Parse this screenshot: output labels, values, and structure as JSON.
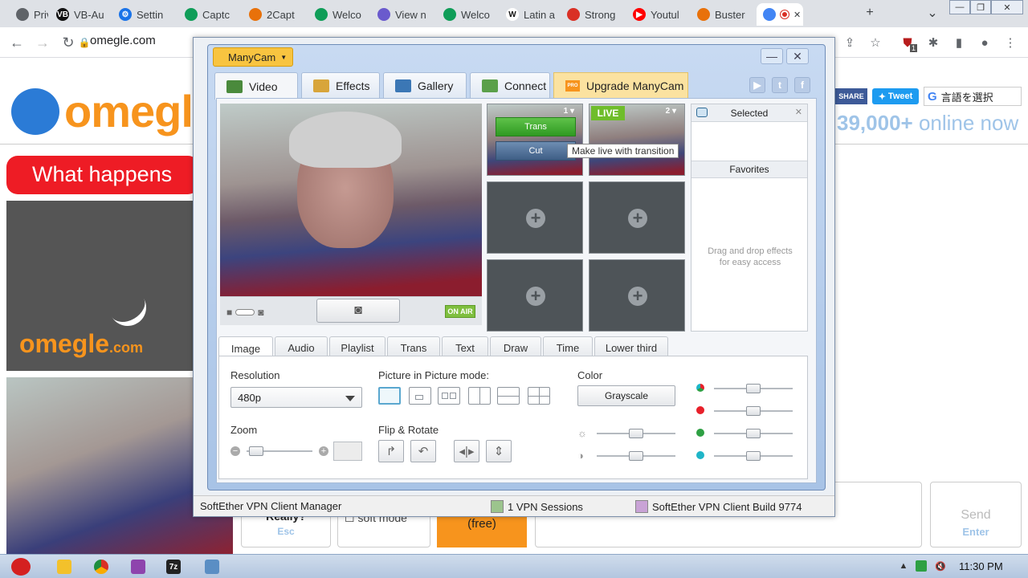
{
  "browser": {
    "tabs": [
      {
        "label": "Privac",
        "fav_color": "#5f6368",
        "fav_text": "",
        "active": false
      },
      {
        "label": "VB-Au",
        "fav_color": "#111111",
        "fav_text": "VB",
        "active": false
      },
      {
        "label": "Settin",
        "fav_color": "#1a73e8",
        "fav_text": "⚙",
        "active": false
      },
      {
        "label": "Captc",
        "fav_color": "#0f9d58",
        "fav_text": "",
        "active": false
      },
      {
        "label": "2Capt",
        "fav_color": "#e8710a",
        "fav_text": "",
        "active": false
      },
      {
        "label": "Welco",
        "fav_color": "#0f9d58",
        "fav_text": "",
        "active": false
      },
      {
        "label": "View n",
        "fav_color": "#6a5acd",
        "fav_text": "",
        "active": false
      },
      {
        "label": "Welco",
        "fav_color": "#0f9d58",
        "fav_text": "",
        "active": false
      },
      {
        "label": "Latin a",
        "fav_color": "#ffffff",
        "fav_text": "W",
        "active": false
      },
      {
        "label": "Strong",
        "fav_color": "#d93025",
        "fav_text": "",
        "active": false
      },
      {
        "label": "Youtul",
        "fav_color": "#ff0000",
        "fav_text": "▶",
        "active": false
      },
      {
        "label": "Buster",
        "fav_color": "#e8710a",
        "fav_text": "",
        "active": false
      },
      {
        "label": "",
        "fav_color": "#4285f4",
        "fav_text": "",
        "active": true
      }
    ],
    "url": "omegle.com",
    "extension_badge": "1"
  },
  "omegle": {
    "logo_text": "omegle",
    "share_label": "SHARE",
    "tweet_label": "Tweet",
    "translate_label": "言語を選択",
    "online_count": "39,000+",
    "online_suffix": " online now",
    "question_banner": "What happens",
    "stranger_logo": "omegle",
    "stranger_logo_suffix": ".com",
    "stop_label": "Really?",
    "stop_key": "Esc",
    "soft_mode_label": "soft mode",
    "free_label": "(free)",
    "send_label": "Send",
    "send_key": "Enter"
  },
  "softether": {
    "status_title": "SoftEther VPN Client Manager",
    "sessions": "1 VPN Sessions",
    "build": "SoftEther VPN Client Build 9774"
  },
  "manycam": {
    "menu_label": "ManyCam",
    "tabs": [
      {
        "label": "Video",
        "color": "#4a8a3c"
      },
      {
        "label": "Effects",
        "color": "#d8a53a"
      },
      {
        "label": "Gallery",
        "color": "#3b77b5"
      },
      {
        "label": "Connect",
        "color": "#5aa04a"
      }
    ],
    "upgrade_label": "Upgrade ManyCam",
    "pro_badge": "PRO",
    "live_label": "LIVE",
    "slot1_num": "1",
    "slot2_num": "2",
    "trans_label": "Trans",
    "cut_label": "Cut",
    "tooltip": "Make live with transition",
    "on_air": "ON AIR",
    "selected_title": "Selected",
    "favorites_title": "Favorites",
    "favorites_hint": "Drag and drop effects for easy access",
    "effect_tabs": [
      "Image",
      "Audio",
      "Playlist",
      "Trans",
      "Text",
      "Draw",
      "Time",
      "Lower third"
    ],
    "active_effect_tab": "Image",
    "resolution_label": "Resolution",
    "resolution_value": "480p",
    "pip_label": "Picture in Picture mode:",
    "color_label": "Color",
    "grayscale_label": "Grayscale",
    "zoom_label": "Zoom",
    "flip_label": "Flip & Rotate",
    "zoom_level": 0.05,
    "brightness_level": 0.5,
    "contrast_level": 0.5,
    "rgb_levels": {
      "all": 0.5,
      "red": 0.5,
      "green": 0.5,
      "blue": 0.5
    },
    "rgb_colors": {
      "red": "#e8202a",
      "green": "#2ea043",
      "blue": "#1fb5c8"
    }
  },
  "taskbar": {
    "clock": "11:30 PM"
  }
}
